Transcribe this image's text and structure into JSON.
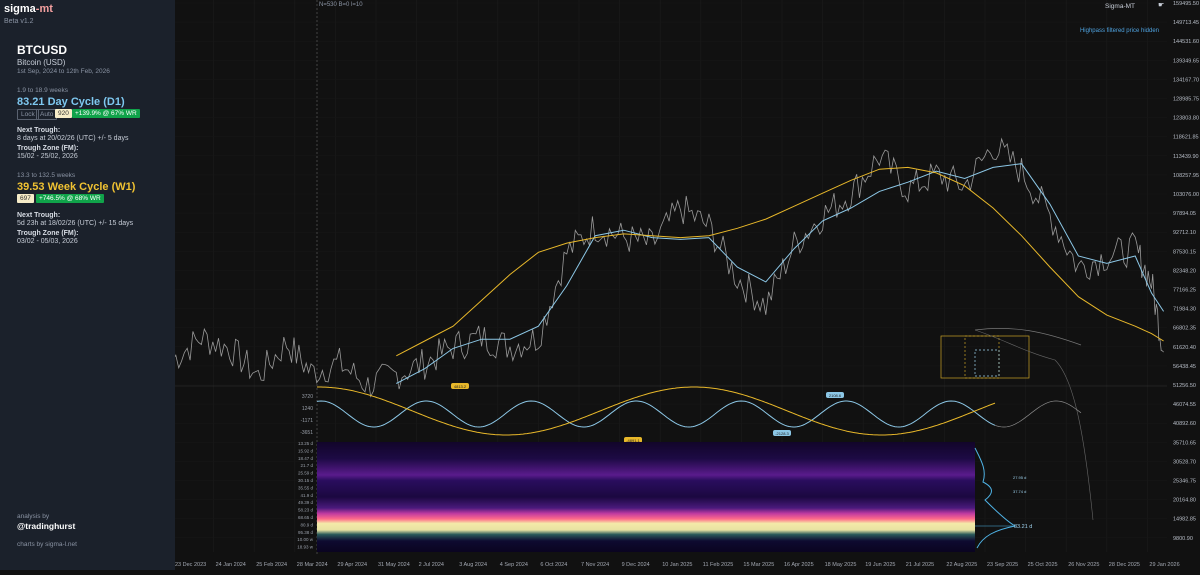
{
  "sidebar": {
    "app_name_a": "sigma",
    "app_name_b": "-mt",
    "version": "Beta v1.2",
    "symbol": "BTCUSD",
    "symbol_name": "Bitcoin (USD)",
    "date_range": "1st Sep, 2024 to 12th Feb, 2026",
    "cycle1": {
      "window": "1.9 to 18.9 weeks",
      "title": "83.21 Day Cycle (D1)",
      "lock_label": "Lock",
      "auto_label": "Auto",
      "count": "920",
      "performance": "+139.9% @ 67% WR",
      "next_trough_label": "Next Trough:",
      "next_trough_value": "8 days at 20/02/26 (UTC) +/- 5 days",
      "zone_label": "Trough Zone (FM):",
      "zone_value": "15/02 - 25/02, 2026"
    },
    "cycle2": {
      "window": "13.3 to 132.5 weeks",
      "title": "39.53 Week Cycle (W1)",
      "count": "697",
      "performance": "+746.5% @ 68% WR",
      "next_trough_label": "Next Trough:",
      "next_trough_value": "5d 23h at 18/02/26 (UTC) +/- 15 days",
      "zone_label": "Trough Zone (FM):",
      "zone_value": "03/02 - 05/03, 2026"
    },
    "analysis_by": "analysis by",
    "handle": "@tradinghurst",
    "charts_by": "charts by sigma-l.net"
  },
  "chart": {
    "stats": "N=530  B=0  l=10",
    "watermark": "Sigma-MT",
    "note": "Highpass filtered price hidden",
    "spectrum_peak": "83.21 d",
    "spectrum_mark_1": "27.95 d",
    "spectrum_mark_2": "37.74 d"
  },
  "chart_data": [
    {
      "type": "line",
      "panel": "price",
      "y_ticks": [
        "159495.50",
        "149713.45",
        "144531.60",
        "139349.65",
        "134167.70",
        "128985.75",
        "123803.80",
        "118621.85",
        "113439.90",
        "108257.95",
        "103076.00",
        "97894.05",
        "92712.10",
        "87530.15",
        "82348.20",
        "77166.25",
        "71984.30",
        "66802.35",
        "61620.40",
        "56438.45",
        "51256.50",
        "46074.55",
        "40892.60",
        "35710.65",
        "30528.70",
        "25346.75",
        "20164.80",
        "14982.85",
        "9800.90"
      ],
      "ylim": [
        9800.9,
        159495.5
      ],
      "x_ticks": [
        "23 Dec 2023",
        "24 Jan 2024",
        "25 Feb 2024",
        "28 Mar 2024",
        "29 Apr 2024",
        "31 May 2024",
        "2 Jul 2024",
        "3 Aug 2024",
        "4 Sep 2024",
        "6 Oct 2024",
        "7 Nov 2024",
        "9 Dec 2024",
        "10 Jan 2025",
        "11 Feb 2025",
        "15 Mar 2025",
        "16 Apr 2025",
        "18 May 2025",
        "19 Jun 2025",
        "21 Jul 2025",
        "22 Aug 2025",
        "23 Sep 2025",
        "25 Oct 2025",
        "26 Nov 2025",
        "28 Dec 2025",
        "29 Jan 2026"
      ],
      "x": [
        0,
        0.7,
        1.4,
        2.1,
        2.8,
        3.4,
        4.1,
        4.8,
        5.5,
        6.2,
        6.9,
        7.6,
        8.3,
        9,
        9.7,
        10.4,
        11.1,
        11.8,
        12.5,
        13.2,
        13.9,
        14.6,
        15.3,
        16,
        16.7,
        17.4,
        18.1,
        18.8,
        19.5,
        20.2,
        20.9,
        21.6,
        22.3,
        23,
        23.7,
        24.1,
        24.4
      ],
      "series": [
        {
          "name": "",
          "color": "#9a9a9a",
          "values": [
            63000,
            69000,
            66000,
            58500,
            67500,
            59500,
            62000,
            56000,
            59000,
            62000,
            66500,
            69000,
            66500,
            69000,
            92000,
            99000,
            96000,
            94000,
            104000,
            99000,
            85000,
            77500,
            94000,
            102000,
            108000,
            118000,
            109000,
            113000,
            110000,
            121000,
            114000,
            102000,
            88000,
            91000,
            93000,
            84000,
            65000
          ]
        },
        {
          "name": "",
          "color": "#8cc7e6",
          "values": [
            null,
            null,
            null,
            null,
            null,
            null,
            null,
            null,
            56500,
            60500,
            66000,
            68500,
            68500,
            72000,
            83000,
            96500,
            98000,
            96000,
            95500,
            96000,
            88000,
            84000,
            93000,
            100500,
            104000,
            108500,
            111000,
            114000,
            112000,
            115000,
            116000,
            105000,
            91000,
            89000,
            91000,
            81000,
            76000
          ]
        },
        {
          "name": "",
          "color": "#e8b82a",
          "values": [
            null,
            null,
            null,
            null,
            null,
            null,
            null,
            null,
            64000,
            68000,
            72000,
            79000,
            86000,
            92000,
            94500,
            96000,
            97000,
            96500,
            96000,
            96500,
            98500,
            101000,
            104500,
            108000,
            111500,
            114500,
            115000,
            113500,
            110000,
            104000,
            96500,
            88000,
            80000,
            75000,
            72000,
            70000,
            68000
          ]
        }
      ]
    },
    {
      "type": "line",
      "panel": "cycle oscillator",
      "y_ticks": [
        "3720",
        "1240",
        "-1171",
        "-3651"
      ],
      "labels": [
        "4813.2",
        "2108.6",
        "-4891.1",
        "-2128.3"
      ],
      "series": [
        {
          "name": "",
          "color": "#8cc7e6",
          "period_days": 83.21
        },
        {
          "name": "",
          "color": "#e8b82a",
          "period_weeks": 39.53
        }
      ]
    },
    {
      "type": "heatmap",
      "panel": "cycle spectrum",
      "y_ticks": [
        "13.25 d",
        "15.92 d",
        "18.47 d",
        "21.7 d",
        "25.59 d",
        "30.15 d",
        "35.55 d",
        "41.9 d",
        "49.39 d",
        "58.23 d",
        "68.65 d",
        "80.9 d",
        "95.38 d",
        "10.00 w",
        "18.93 w"
      ],
      "peak": "83.21 d"
    }
  ]
}
